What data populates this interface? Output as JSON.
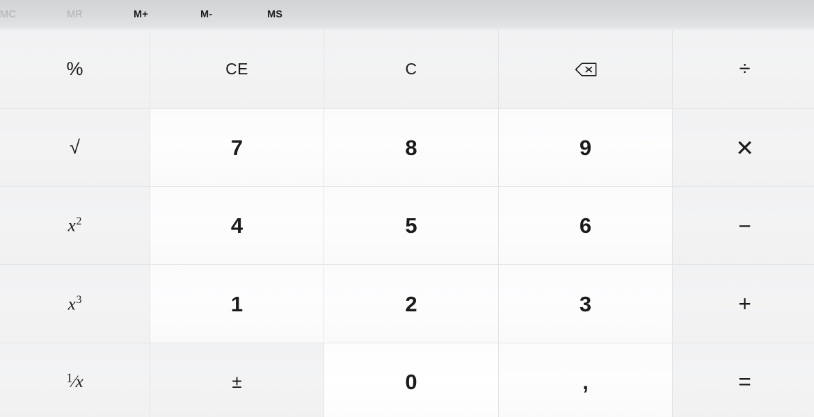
{
  "app": {
    "title": "Calculator",
    "theme": "light",
    "mode": "standard"
  },
  "colors": {
    "memory_bar_top": "#d2d4d7",
    "memory_bar_bottom": "#e4e5e7",
    "function_key_bg": "#f2f2f3",
    "number_key_bg": "#fcfcfd",
    "number_key_hover_bg": "#ffffff",
    "grid_line": "#e3e4e6",
    "text_enabled": "#1b1b1b",
    "text_disabled": "#aeb0b3"
  },
  "memory_bar": {
    "buttons": [
      {
        "id": "memory-clear",
        "label": "MC",
        "enabled": false
      },
      {
        "id": "memory-recall",
        "label": "MR",
        "enabled": false
      },
      {
        "id": "memory-add",
        "label": "M+",
        "enabled": true
      },
      {
        "id": "memory-subtract",
        "label": "M-",
        "enabled": true
      },
      {
        "id": "memory-store",
        "label": "MS",
        "enabled": true
      }
    ]
  },
  "keypad": {
    "rows": [
      [
        {
          "id": "percent",
          "label": "%",
          "kind": "function"
        },
        {
          "id": "clear-entry",
          "label": "CE",
          "kind": "function"
        },
        {
          "id": "clear",
          "label": "C",
          "kind": "function"
        },
        {
          "id": "backspace",
          "label": "⌫",
          "kind": "function",
          "icon": "backspace-icon"
        },
        {
          "id": "divide",
          "label": "÷",
          "kind": "operator"
        }
      ],
      [
        {
          "id": "square-root",
          "label": "√",
          "kind": "function"
        },
        {
          "id": "seven",
          "label": "7",
          "kind": "number"
        },
        {
          "id": "eight",
          "label": "8",
          "kind": "number"
        },
        {
          "id": "nine",
          "label": "9",
          "kind": "number"
        },
        {
          "id": "multiply",
          "label": "✕",
          "kind": "operator"
        }
      ],
      [
        {
          "id": "square",
          "label": "x²",
          "kind": "function"
        },
        {
          "id": "four",
          "label": "4",
          "kind": "number"
        },
        {
          "id": "five",
          "label": "5",
          "kind": "number"
        },
        {
          "id": "six",
          "label": "6",
          "kind": "number"
        },
        {
          "id": "subtract",
          "label": "−",
          "kind": "operator"
        }
      ],
      [
        {
          "id": "cube",
          "label": "x³",
          "kind": "function"
        },
        {
          "id": "one",
          "label": "1",
          "kind": "number"
        },
        {
          "id": "two",
          "label": "2",
          "kind": "number"
        },
        {
          "id": "three",
          "label": "3",
          "kind": "number"
        },
        {
          "id": "add",
          "label": "+",
          "kind": "operator"
        }
      ],
      [
        {
          "id": "reciprocal",
          "label": "¹⁄x",
          "kind": "function"
        },
        {
          "id": "negate",
          "label": "±",
          "kind": "function"
        },
        {
          "id": "zero",
          "label": "0",
          "kind": "number",
          "hover": true
        },
        {
          "id": "decimal",
          "label": ",",
          "kind": "number"
        },
        {
          "id": "equals",
          "label": "=",
          "kind": "operator"
        }
      ]
    ]
  }
}
